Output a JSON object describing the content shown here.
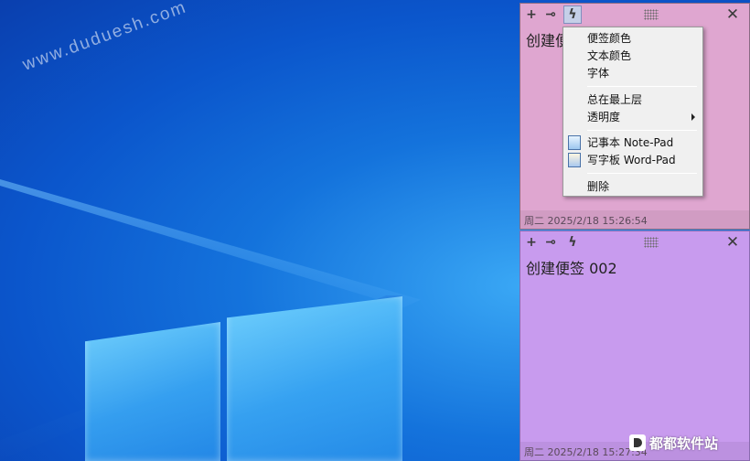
{
  "desktop": {
    "watermark": "www.duduesh.com"
  },
  "toolbar": {
    "add_glyph": "+",
    "pin_glyph": "⊸",
    "menu_glyph": "ϟ",
    "close_glyph": "✕"
  },
  "notes": [
    {
      "text": "创建便签 001",
      "footer": "周二 2025/2/18 15:26:54",
      "color": "#dfa6d0"
    },
    {
      "text": "创建便签 002",
      "footer": "周二 2025/2/18 15:27:34",
      "color": "#c89bee"
    }
  ],
  "context_menu": {
    "items": [
      "便签颜色",
      "文本颜色",
      "字体",
      "总在最上层",
      "透明度",
      "记事本 Note-Pad",
      "写字板 Word-Pad",
      "删除"
    ]
  },
  "brand": {
    "name": "都都软件站"
  }
}
